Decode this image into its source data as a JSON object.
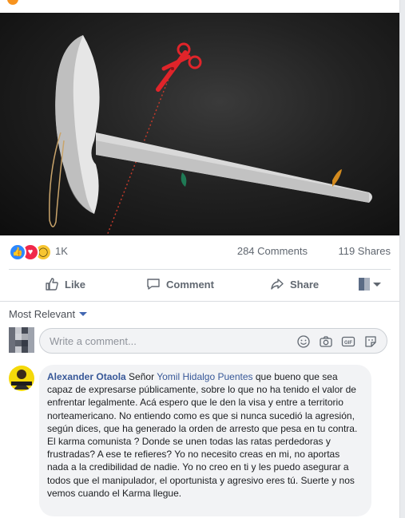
{
  "post": {
    "reactions": {
      "icons": [
        "like-icon",
        "love-icon",
        "wow-icon"
      ],
      "count": "1K"
    },
    "comments_count": "284 Comments",
    "shares_count": "119 Shares"
  },
  "actions": {
    "like_label": "Like",
    "comment_label": "Comment",
    "share_label": "Share"
  },
  "comments_section": {
    "sort_label": "Most Relevant",
    "input_placeholder": "Write a comment...",
    "input_icons": [
      "emoji-icon",
      "camera-icon",
      "gif-icon",
      "sticker-icon"
    ]
  },
  "comment": {
    "author": "Alexander Otaola",
    "greeting": "Señor",
    "mention": "Yomil Hidalgo Puentes",
    "body": "que bueno que sea capaz de expresarse públicamente, sobre lo que no ha tenido el valor de enfrentar legalmente. Acá espero que le den la visa y entre a territorio norteamericano. No entiendo como es que si nunca sucedió la agresión, según dices, que ha generado la orden de arresto que pesa en tu contra. El karma comunista ? Donde se unen todas las ratas perdedoras y frustradas? A ese te refieres? Yo no necesito creas en mi, no aportas nada a la credibilidad de nadie. Yo no creo en ti y les puedo asegurar a todos que el manipulador, el oportunista y agresivo eres tú. Suerte y nos vemos cuando el Karma llegue."
  },
  "colors": {
    "link": "#385898",
    "like_blue": "#2d88ff",
    "love_red": "#f0284a",
    "wow_yellow": "#f7c531",
    "scissors_red": "#e0242a"
  }
}
